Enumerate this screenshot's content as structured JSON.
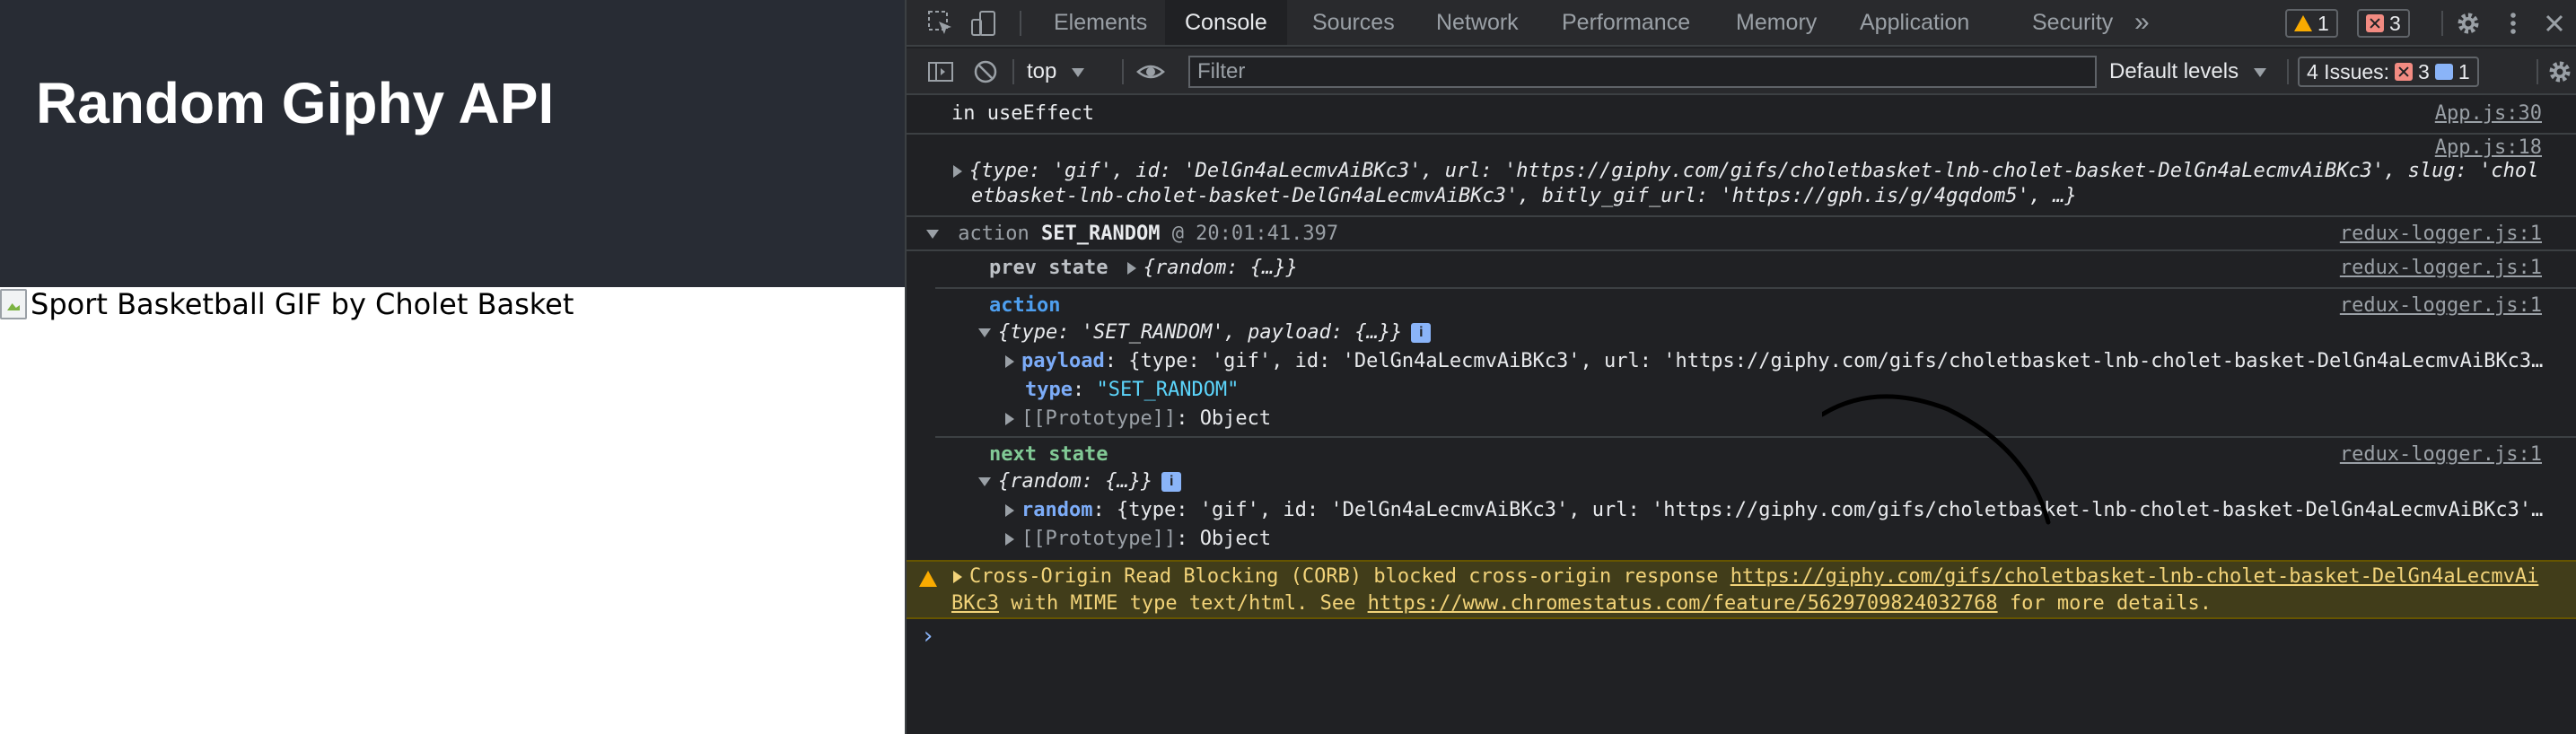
{
  "page": {
    "title": "Random Giphy API",
    "image_alt": "Sport Basketball GIF by Cholet Basket"
  },
  "devtools": {
    "tabs": [
      "Elements",
      "Console",
      "Sources",
      "Network",
      "Performance",
      "Memory",
      "Application",
      "Security"
    ],
    "active_tab": "Console",
    "more_tabs": "»",
    "warnings_count": "1",
    "errors_count": "3",
    "toolbar": {
      "context": "top",
      "filter_placeholder": "Filter",
      "levels": "Default levels",
      "issues_label": "4 Issues:",
      "issues_errors": "3",
      "issues_info": "1"
    },
    "console": {
      "log1_text": "in useEffect",
      "log1_src": "App.js:30",
      "log2_src": "App.js:18",
      "log2_line1": "{type: 'gif', id: 'DelGn4aLecmvAiBKc3', url: 'https://giphy.com/gifs/choletbasket-lnb-cholet-basket-DelGn4aLecmvAiBKc3', slug: 'chol",
      "log2_line2": "etbasket-lnb-cholet-basket-DelGn4aLecmvAiBKc3', bitly_gif_url: 'https://gph.is/g/4gqdom5', …}",
      "action_prefix": "action",
      "action_name": "SET_RANDOM",
      "action_time": "@ 20:01:41.397",
      "redux_src": "redux-logger.js:1",
      "prev_state_label": "prev state",
      "prev_state_value": "{random: {…}}",
      "action_label": "action",
      "action_obj": "{type: 'SET_RANDOM', payload: {…}}",
      "payload_key": "payload",
      "payload_value": "{type: 'gif', id: 'DelGn4aLecmvAiBKc3', url: 'https://giphy.com/gifs/choletbasket-lnb-cholet-basket-DelGn4aLecmvAiBKc3…",
      "type_key": "type",
      "type_value": "\"SET_RANDOM\"",
      "proto_key": "[[Prototype]]",
      "proto_value": "Object",
      "next_state_label": "next state",
      "next_state_value": "{random: {…}}",
      "random_key": "random",
      "random_value": "{type: 'gif', id: 'DelGn4aLecmvAiBKc3', url: 'https://giphy.com/gifs/choletbasket-lnb-cholet-basket-DelGn4aLecmvAiBKc3'…",
      "warn_line1_prefix": "Cross-Origin Read Blocking (CORB) blocked cross-origin response ",
      "warn_link1_a": "https://giphy.com/gifs/choletbasket-lnb-cholet-basket-DelGn4aLecmvAi",
      "warn_link1_b": "BKc3",
      "warn_line2_mid": " with MIME type text/html. See ",
      "warn_link2": "https://www.chromestatus.com/feature/5629709824032768",
      "warn_line2_end": " for more details.",
      "prompt": "›"
    }
  },
  "colors": {
    "header_bg": "#282c34",
    "devtools_bg": "#202124",
    "warning_bg": "#413d1a"
  }
}
